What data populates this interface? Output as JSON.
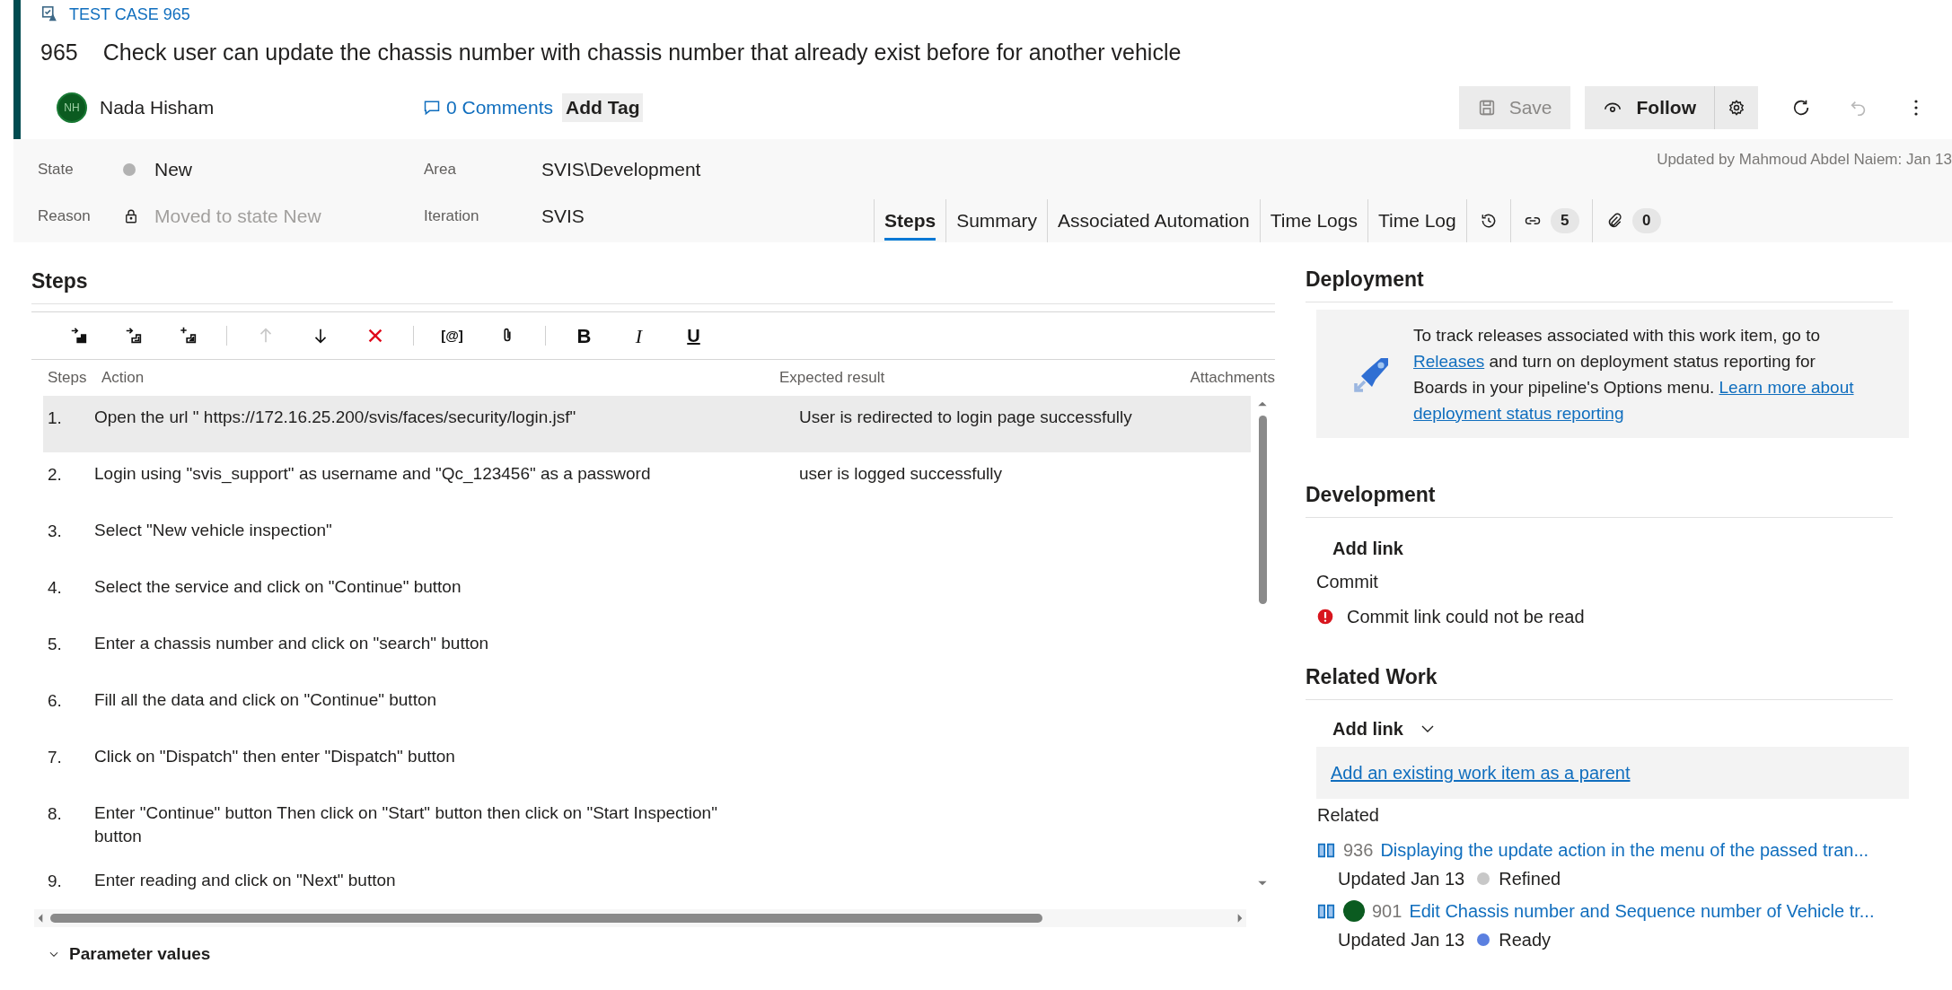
{
  "work_item": {
    "type_label": "TEST CASE 965",
    "id": "965",
    "title": "Check user can update the chassis number with chassis number that already exist before for another vehicle",
    "assigned_to": {
      "initials": "NH",
      "name": "Nada Hisham"
    },
    "comments": "0 Comments",
    "add_tag": "Add Tag"
  },
  "header_buttons": [
    {
      "kind": "save",
      "label": "Save",
      "disabled": true
    },
    {
      "kind": "follow",
      "label": "Follow",
      "disabled": false
    },
    {
      "kind": "settings",
      "disabled": false
    },
    {
      "kind": "refresh",
      "disabled": false
    },
    {
      "kind": "undo",
      "disabled": true
    },
    {
      "kind": "more",
      "disabled": false
    }
  ],
  "fields": [
    {
      "label": "State",
      "value": "New",
      "kind": "state"
    },
    {
      "label": "Reason",
      "value": "Moved to state New",
      "kind": "locked"
    },
    {
      "label": "Area",
      "value": "SVIS\\Development",
      "kind": "text"
    },
    {
      "label": "Iteration",
      "value": "SVIS",
      "kind": "text"
    }
  ],
  "updated_by": "Updated by Mahmoud Abdel Naiem: Jan 13",
  "tabs": [
    {
      "label": "Steps",
      "selected": true
    },
    {
      "label": "Summary",
      "selected": false
    },
    {
      "label": "Associated Automation",
      "selected": false
    },
    {
      "label": "Time Logs",
      "selected": false
    },
    {
      "label": "Time Log",
      "selected": false
    }
  ],
  "tab_icons": [
    {
      "kind": "history"
    },
    {
      "kind": "links",
      "count": "5"
    },
    {
      "kind": "attachments",
      "count": "0"
    }
  ],
  "steps": {
    "title": "Steps",
    "toolbar": [
      {
        "kind": "insert-step",
        "disabled": false
      },
      {
        "kind": "insert-shared",
        "disabled": false
      },
      {
        "kind": "create-shared",
        "disabled": false
      },
      {
        "kind": "separator"
      },
      {
        "kind": "move-up",
        "disabled": true
      },
      {
        "kind": "move-down",
        "disabled": false
      },
      {
        "kind": "delete",
        "disabled": false
      },
      {
        "kind": "separator"
      },
      {
        "kind": "parameter",
        "label": "[@]",
        "disabled": false
      },
      {
        "kind": "attach",
        "disabled": false
      },
      {
        "kind": "separator"
      },
      {
        "kind": "bold",
        "label": "B",
        "disabled": false
      },
      {
        "kind": "italic",
        "label": "I",
        "disabled": false
      },
      {
        "kind": "underline",
        "label": "U",
        "disabled": false
      }
    ],
    "columns": [
      "Steps",
      "Action",
      "Expected result",
      "Attachments"
    ],
    "rows": [
      {
        "number": "1.",
        "action": "Open the url \" https://172.16.25.200/svis/faces/security/login.jsf\"",
        "expected": "User is redirected to login page successfully",
        "selected": true
      },
      {
        "number": "2.",
        "action": "Login using \"svis_support\" as username and \"Qc_123456\" as a password",
        "expected": "user is logged successfully",
        "selected": false
      },
      {
        "number": "3.",
        "action": "Select \"New vehicle inspection\"",
        "selected": false
      },
      {
        "number": "4.",
        "action": "Select the service and  click on \"Continue\"  button",
        "selected": false
      },
      {
        "number": "5.",
        "action": "Enter a chassis number and click on  \"search\" button",
        "selected": false
      },
      {
        "number": "6.",
        "action": "Fill all the data and click on \"Continue\" button",
        "selected": false
      },
      {
        "number": "7.",
        "action": "Click on \"Dispatch\" then enter \"Dispatch\" button",
        "selected": false
      },
      {
        "number": "8.",
        "action": "Enter \"Continue\" button Then click on \"Start\" button then click on \"Start Inspection\" button",
        "selected": false
      },
      {
        "number": "9.",
        "action": "Enter reading and click on \"Next\" button",
        "selected": false
      }
    ]
  },
  "parameter_values": "Parameter values",
  "deployment": {
    "title": "Deployment",
    "parts": [
      {
        "text": "To track releases associated with this work item, go to "
      },
      {
        "link": "Releases"
      },
      {
        "text": " and turn on deployment status reporting for Boards in your pipeline's Options menu. "
      },
      {
        "link": "Learn more about"
      },
      {
        "link": "deployment status reporting"
      }
    ]
  },
  "development": {
    "title": "Development",
    "add_link": "Add link",
    "group": "Commit",
    "error": "Commit link could not be read"
  },
  "related_work": {
    "title": "Related Work",
    "add_link": "Add link",
    "add_parent": "Add an existing work item as a parent",
    "group": "Related",
    "items": [
      {
        "id": "936",
        "title": "Displaying the update action in the menu of the passed tran...",
        "updated": "Updated Jan 13",
        "state": "Refined",
        "color": "#c8c8c8",
        "avatar": false
      },
      {
        "id": "901",
        "title": "Edit Chassis number and Sequence number of Vehicle tr...",
        "updated": "Updated Jan 13",
        "state": "Ready",
        "color": "#5b80e0",
        "avatar": true
      }
    ]
  }
}
